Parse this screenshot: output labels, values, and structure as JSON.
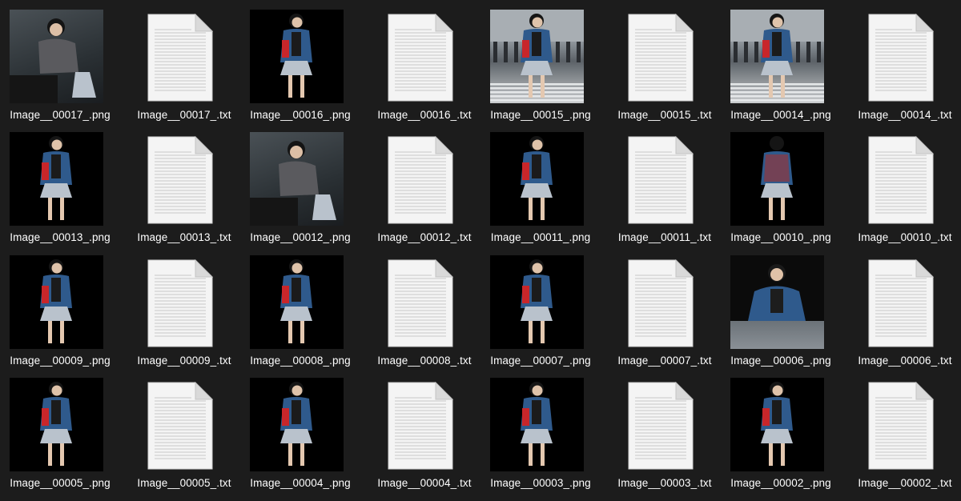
{
  "files": [
    {
      "name": "Image__00017_.png",
      "kind": "png",
      "scene": "grey-studio"
    },
    {
      "name": "Image__00017_.txt",
      "kind": "txt"
    },
    {
      "name": "Image__00016_.png",
      "kind": "png",
      "scene": "black-side"
    },
    {
      "name": "Image__00016_.txt",
      "kind": "txt"
    },
    {
      "name": "Image__00015_.png",
      "kind": "png",
      "scene": "street"
    },
    {
      "name": "Image__00015_.txt",
      "kind": "txt"
    },
    {
      "name": "Image__00014_.png",
      "kind": "png",
      "scene": "street"
    },
    {
      "name": "Image__00014_.txt",
      "kind": "txt"
    },
    {
      "name": "Image__00013_.png",
      "kind": "png",
      "scene": "black-side"
    },
    {
      "name": "Image__00013_.txt",
      "kind": "txt"
    },
    {
      "name": "Image__00012_.png",
      "kind": "png",
      "scene": "grey-studio"
    },
    {
      "name": "Image__00012_.txt",
      "kind": "txt"
    },
    {
      "name": "Image__00011_.png",
      "kind": "png",
      "scene": "black-side"
    },
    {
      "name": "Image__00011_.txt",
      "kind": "txt"
    },
    {
      "name": "Image__00010_.png",
      "kind": "png",
      "scene": "black-back"
    },
    {
      "name": "Image__00010_.txt",
      "kind": "txt"
    },
    {
      "name": "Image__00009_.png",
      "kind": "png",
      "scene": "black-side"
    },
    {
      "name": "Image__00009_.txt",
      "kind": "txt"
    },
    {
      "name": "Image__00008_.png",
      "kind": "png",
      "scene": "black-front"
    },
    {
      "name": "Image__00008_.txt",
      "kind": "txt"
    },
    {
      "name": "Image__00007_.png",
      "kind": "png",
      "scene": "black-front"
    },
    {
      "name": "Image__00007_.txt",
      "kind": "txt"
    },
    {
      "name": "Image__00006_.png",
      "kind": "png",
      "scene": "table"
    },
    {
      "name": "Image__00006_.txt",
      "kind": "txt"
    },
    {
      "name": "Image__00005_.png",
      "kind": "png",
      "scene": "black-side"
    },
    {
      "name": "Image__00005_.txt",
      "kind": "txt"
    },
    {
      "name": "Image__00004_.png",
      "kind": "png",
      "scene": "black-front"
    },
    {
      "name": "Image__00004_.txt",
      "kind": "txt"
    },
    {
      "name": "Image__00003_.png",
      "kind": "png",
      "scene": "black-front"
    },
    {
      "name": "Image__00003_.txt",
      "kind": "txt"
    },
    {
      "name": "Image__00002_.png",
      "kind": "png",
      "scene": "black-side"
    },
    {
      "name": "Image__00002_.txt",
      "kind": "txt"
    }
  ],
  "icons": {
    "txt": "text-document-icon",
    "png": "image-thumbnail"
  },
  "colors": {
    "background": "#1c1c1c",
    "label": "#ffffff",
    "jacket_blue": "#2f5a8c",
    "jacket_red": "#c8262a",
    "skirt": "#b9c2cc"
  }
}
